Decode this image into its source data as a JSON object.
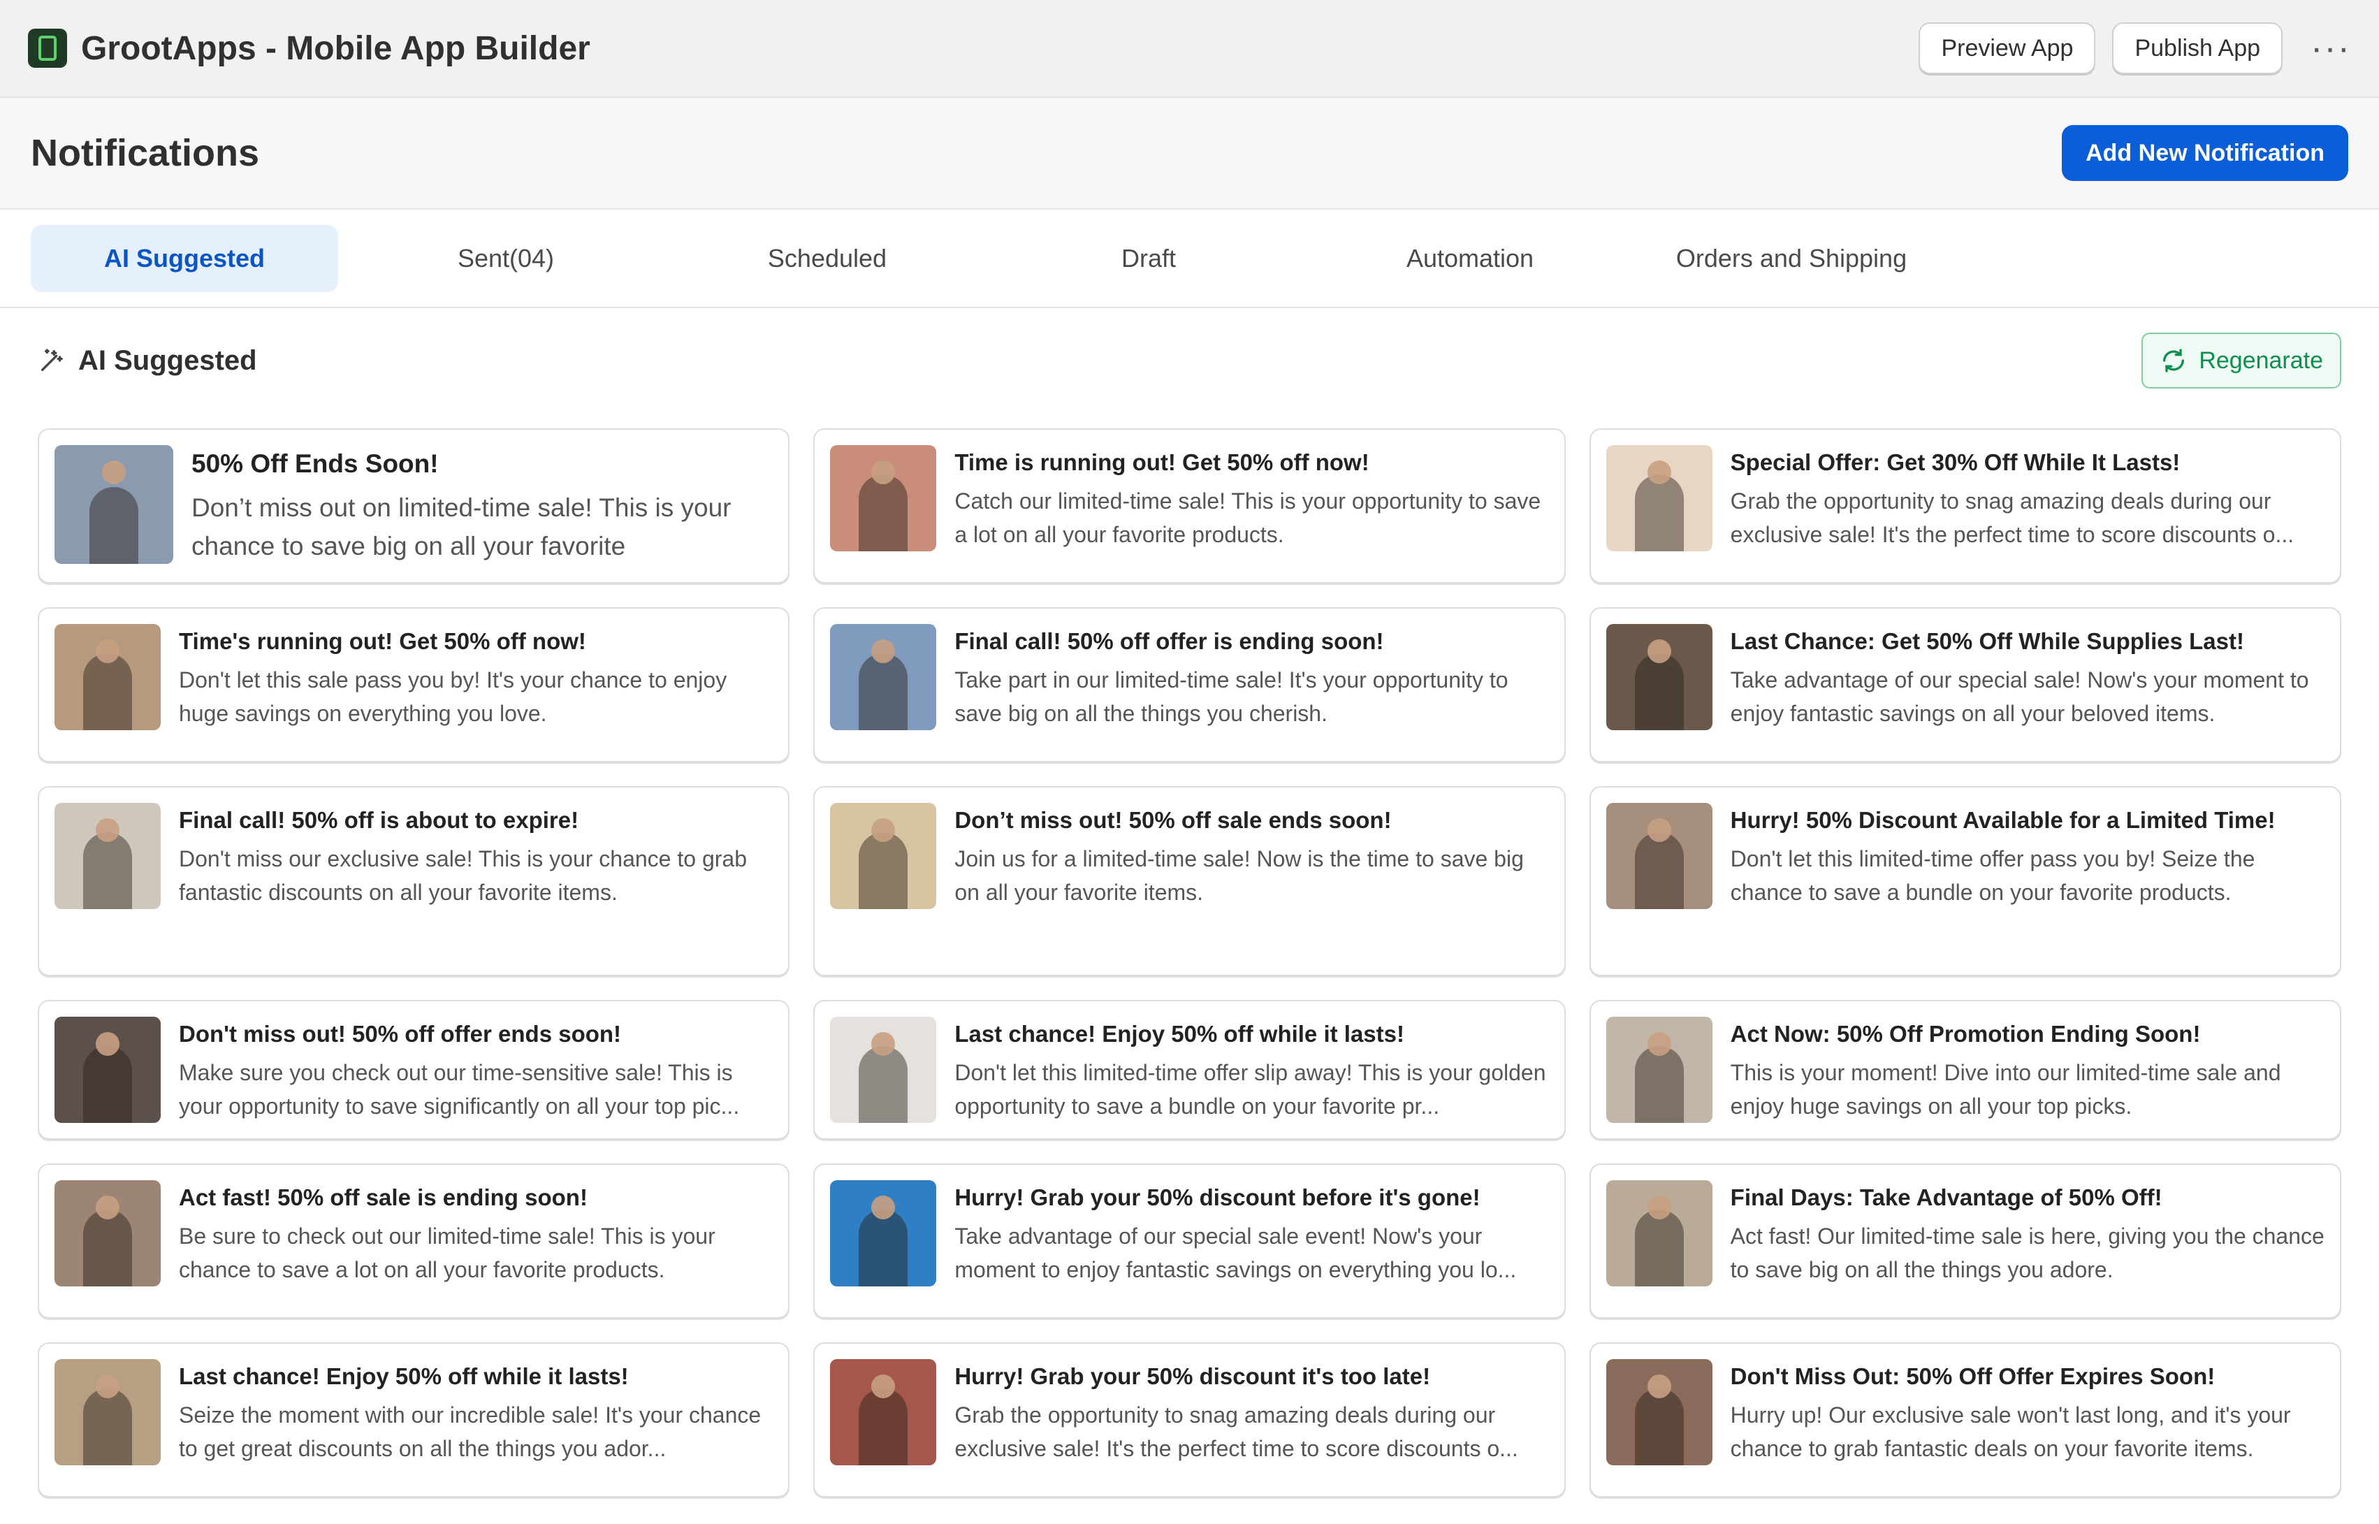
{
  "app": {
    "title": "GrootApps - Mobile App Builder",
    "preview_label": "Preview App",
    "publish_label": "Publish App",
    "more_label": "···"
  },
  "header": {
    "title": "Notifications",
    "add_label": "Add New Notification"
  },
  "tabs": [
    {
      "label": "AI Suggested",
      "active": true
    },
    {
      "label": "Sent(04)"
    },
    {
      "label": "Scheduled"
    },
    {
      "label": "Draft"
    },
    {
      "label": "Automation"
    },
    {
      "label": "Orders and Shipping"
    }
  ],
  "section": {
    "title": "AI Suggested",
    "regenerate_label": "Regenarate"
  },
  "colors": {
    "accent": "#0a5fd8",
    "tab_active_bg": "#e6f0fc",
    "regen_green": "#0d8f4f"
  },
  "cards": [
    {
      "title": "50% Off Ends Soon!",
      "text": "Don’t miss out on limited-time sale! This is your chance to save big on all your favorite",
      "thumb": "#8a9bb0"
    },
    {
      "title": "Time is running out! Get 50% off now!",
      "text": "Catch our limited-time sale! This is your opportunity to save a lot on all your favorite products.",
      "thumb": "#c98d7a"
    },
    {
      "title": "Special Offer: Get 30% Off While It Lasts!",
      "text": "Grab the opportunity to snag amazing deals during our exclusive sale! It's the perfect time to score discounts o...",
      "thumb": "#e8d6c4"
    },
    {
      "title": "Time's running out! Get 50% off now!",
      "text": "Don't let this sale pass you by! It's your chance to enjoy huge savings on everything you love.",
      "thumb": "#b69a7e"
    },
    {
      "title": "Final call! 50% off offer is ending soon!",
      "text": "Take part in our limited-time sale! It's your opportunity to save big on all the things you cherish.",
      "thumb": "#7f9bbd"
    },
    {
      "title": "Last Chance: Get 50% Off While Supplies Last!",
      "text": "Take advantage of our special sale! Now's your moment to enjoy fantastic savings on all your beloved items.",
      "thumb": "#6b5a4c"
    },
    {
      "title": "Final call! 50% off is about to expire!",
      "text": "Don't miss our exclusive sale! This is your chance to grab fantastic discounts on all your favorite items.",
      "thumb": "#cfc7bc"
    },
    {
      "title": "Don’t miss out! 50% off sale ends soon!",
      "text": "Join us for a limited-time sale! Now is the time to save big on all your favorite items.",
      "thumb": "#d7c4a1"
    },
    {
      "title": "Hurry! 50% Discount Available for a Limited Time!",
      "text": "Don't let this limited-time offer pass you by! Seize the chance to save a bundle on your favorite products.",
      "thumb": "#a78f7d"
    },
    {
      "title": "Don't miss out! 50% off offer ends soon!",
      "text": "Make sure you check out our time-sensitive sale! This is your opportunity to save significantly on all your top pic...",
      "thumb": "#5c514a"
    },
    {
      "title": "Last chance! Enjoy 50% off while it lasts!",
      "text": "Don't let this limited-time offer slip away! This is your golden opportunity to save a bundle on your favorite pr...",
      "thumb": "#e5e2dd"
    },
    {
      "title": "Act Now: 50% Off Promotion Ending Soon!",
      "text": "This is your moment! Dive into our limited-time sale and enjoy huge savings on all your top picks.",
      "thumb": "#c2b6a8"
    },
    {
      "title": "Act fast! 50% off sale is ending soon!",
      "text": "Be sure to check out our limited-time sale! This is your chance to save a lot on all your favorite products.",
      "thumb": "#9c8575"
    },
    {
      "title": "Hurry! Grab your 50% discount before it's gone!",
      "text": "Take advantage of our special sale event! Now's your moment to enjoy fantastic savings on everything you lo...",
      "thumb": "#2f7fc4"
    },
    {
      "title": "Final Days: Take Advantage of 50% Off!",
      "text": "Act fast! Our limited-time sale is here, giving you the chance to save big on all the things you adore.",
      "thumb": "#b9ab98"
    },
    {
      "title": "Last chance! Enjoy 50% off while it lasts!",
      "text": "Seize the moment with our incredible sale! It's your chance to get great discounts on all the things you ador...",
      "thumb": "#b79f84"
    },
    {
      "title": "Hurry! Grab your 50% discount  it's too late!",
      "text": "Grab the opportunity to snag amazing deals during our exclusive sale! It's the perfect time to score discounts o...",
      "thumb": "#a4574a"
    },
    {
      "title": "Don't Miss Out: 50% Off Offer Expires Soon!",
      "text": "Hurry up! Our exclusive sale won't last long, and it's your chance to grab fantastic deals on your favorite items.",
      "thumb": "#8a6a5a"
    }
  ]
}
